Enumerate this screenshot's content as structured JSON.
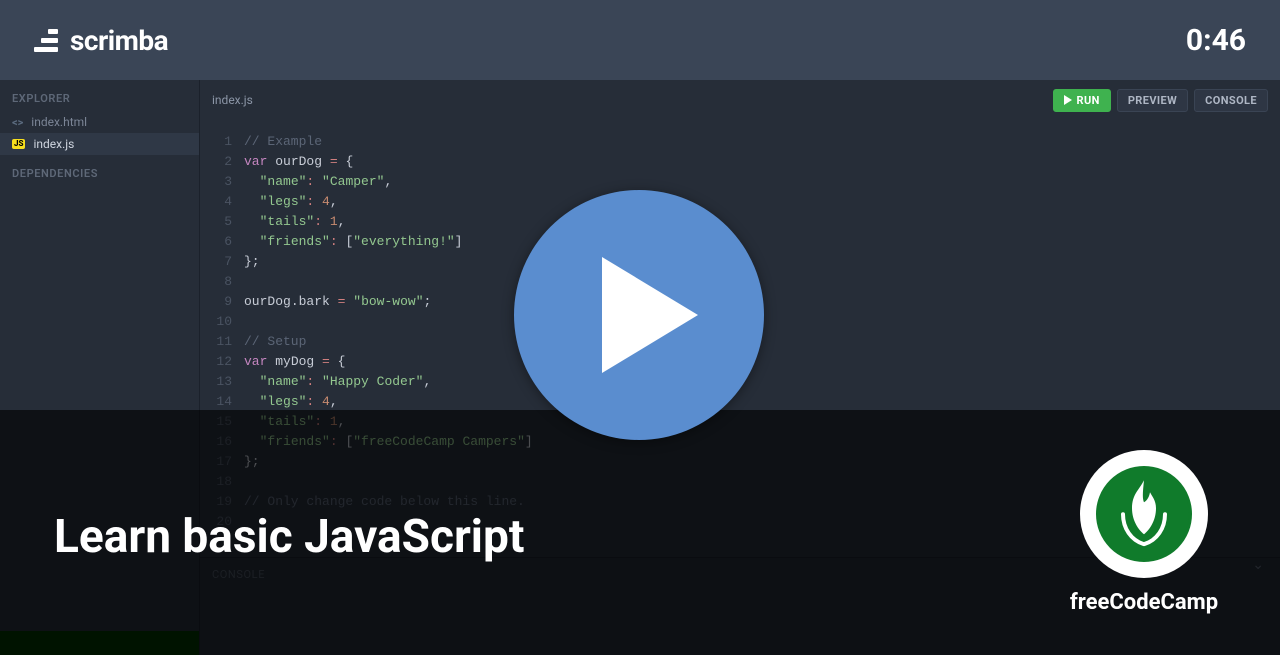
{
  "brand": "scrimba",
  "timestamp": "0:46",
  "sidebar": {
    "explorer_label": "EXPLORER",
    "dependencies_label": "DEPENDENCIES",
    "files": [
      {
        "name": "index.html",
        "icon": "html",
        "active": false
      },
      {
        "name": "index.js",
        "icon": "js",
        "active": true
      }
    ]
  },
  "editor": {
    "tab_title": "index.js",
    "buttons": {
      "run": "RUN",
      "preview": "PREVIEW",
      "console": "CONSOLE"
    },
    "code": [
      [
        [
          "comment",
          "// Example"
        ]
      ],
      [
        [
          "keyword",
          "var"
        ],
        [
          "punc",
          " "
        ],
        [
          "ident",
          "ourDog"
        ],
        [
          "punc",
          " "
        ],
        [
          "op",
          "="
        ],
        [
          "punc",
          " {"
        ]
      ],
      [
        [
          "punc",
          "  "
        ],
        [
          "string",
          "\"name\""
        ],
        [
          "op",
          ":"
        ],
        [
          "punc",
          " "
        ],
        [
          "string",
          "\"Camper\""
        ],
        [
          "punc",
          ","
        ]
      ],
      [
        [
          "punc",
          "  "
        ],
        [
          "string",
          "\"legs\""
        ],
        [
          "op",
          ":"
        ],
        [
          "punc",
          " "
        ],
        [
          "number",
          "4"
        ],
        [
          "punc",
          ","
        ]
      ],
      [
        [
          "punc",
          "  "
        ],
        [
          "string",
          "\"tails\""
        ],
        [
          "op",
          ":"
        ],
        [
          "punc",
          " "
        ],
        [
          "number",
          "1"
        ],
        [
          "punc",
          ","
        ]
      ],
      [
        [
          "punc",
          "  "
        ],
        [
          "string",
          "\"friends\""
        ],
        [
          "op",
          ":"
        ],
        [
          "punc",
          " ["
        ],
        [
          "string",
          "\"everything!\""
        ],
        [
          "punc",
          "]"
        ]
      ],
      [
        [
          "punc",
          "};"
        ]
      ],
      [],
      [
        [
          "ident",
          "ourDog"
        ],
        [
          "punc",
          "."
        ],
        [
          "ident",
          "bark"
        ],
        [
          "punc",
          " "
        ],
        [
          "op",
          "="
        ],
        [
          "punc",
          " "
        ],
        [
          "string",
          "\"bow-wow\""
        ],
        [
          "punc",
          ";"
        ]
      ],
      [],
      [
        [
          "comment",
          "// Setup"
        ]
      ],
      [
        [
          "keyword",
          "var"
        ],
        [
          "punc",
          " "
        ],
        [
          "ident",
          "myDog"
        ],
        [
          "punc",
          " "
        ],
        [
          "op",
          "="
        ],
        [
          "punc",
          " {"
        ]
      ],
      [
        [
          "punc",
          "  "
        ],
        [
          "string",
          "\"name\""
        ],
        [
          "op",
          ":"
        ],
        [
          "punc",
          " "
        ],
        [
          "string",
          "\"Happy Coder\""
        ],
        [
          "punc",
          ","
        ]
      ],
      [
        [
          "punc",
          "  "
        ],
        [
          "string",
          "\"legs\""
        ],
        [
          "op",
          ":"
        ],
        [
          "punc",
          " "
        ],
        [
          "number",
          "4"
        ],
        [
          "punc",
          ","
        ]
      ],
      [
        [
          "punc",
          "  "
        ],
        [
          "string",
          "\"tails\""
        ],
        [
          "op",
          ":"
        ],
        [
          "punc",
          " "
        ],
        [
          "number",
          "1"
        ],
        [
          "punc",
          ","
        ]
      ],
      [
        [
          "punc",
          "  "
        ],
        [
          "string",
          "\"friends\""
        ],
        [
          "op",
          ":"
        ],
        [
          "punc",
          " ["
        ],
        [
          "string",
          "\"freeCodeCamp Campers\""
        ],
        [
          "punc",
          "]"
        ]
      ],
      [
        [
          "punc",
          "};"
        ]
      ],
      [],
      [
        [
          "comment",
          "// Only change code below this line."
        ]
      ],
      []
    ]
  },
  "console": {
    "label": "CONSOLE"
  },
  "overlay": {
    "lesson_title": "Learn basic JavaScript",
    "org_name": "freeCodeCamp"
  }
}
